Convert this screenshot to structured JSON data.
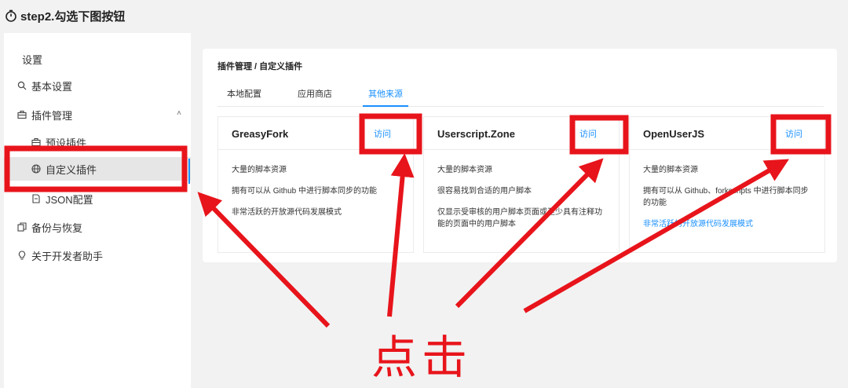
{
  "topbar": {
    "title": "step2.勾选下图按钮",
    "icon": "timer-icon"
  },
  "sidebar": {
    "heading": "设置",
    "items": [
      {
        "label": "基本设置",
        "icon": "search-icon"
      },
      {
        "label": "插件管理",
        "icon": "briefcase-icon"
      },
      {
        "label": "预设插件",
        "icon": "briefcase-icon"
      },
      {
        "label": "自定义插件",
        "icon": "globe-icon"
      },
      {
        "label": "JSON配置",
        "icon": "file-icon"
      },
      {
        "label": "备份与恢复",
        "icon": "copy-icon"
      },
      {
        "label": "关于开发者助手",
        "icon": "bulb-icon"
      }
    ]
  },
  "panel": {
    "breadcrumb": "插件管理 / 自定义插件",
    "tabs": [
      "本地配置",
      "应用商店",
      "其他来源"
    ],
    "active_tab": "其他来源",
    "cards": [
      {
        "title": "GreasyFork",
        "visit": "访问",
        "lines": [
          "大量的脚本资源",
          "拥有可以从 Github 中进行脚本同步的功能",
          "非常活跃的开放源代码发展模式"
        ]
      },
      {
        "title": "Userscript.Zone",
        "visit": "访问",
        "lines": [
          "大量的脚本资源",
          "很容易找到合适的用户脚本",
          "仅显示受审核的用户脚本页面或至少具有注释功能的页面中的用户脚本"
        ]
      },
      {
        "title": "OpenUserJS",
        "visit": "访问",
        "lines": [
          "大量的脚本资源",
          "拥有可以从 Github、forkscripts 中进行脚本同步的功能",
          "非常活跃的开放源代码发展模式"
        ]
      }
    ]
  },
  "annotation": {
    "label": "点击",
    "color": "#e8141b"
  },
  "colors": {
    "accent": "#1890ff",
    "annotation": "#e8141b"
  }
}
